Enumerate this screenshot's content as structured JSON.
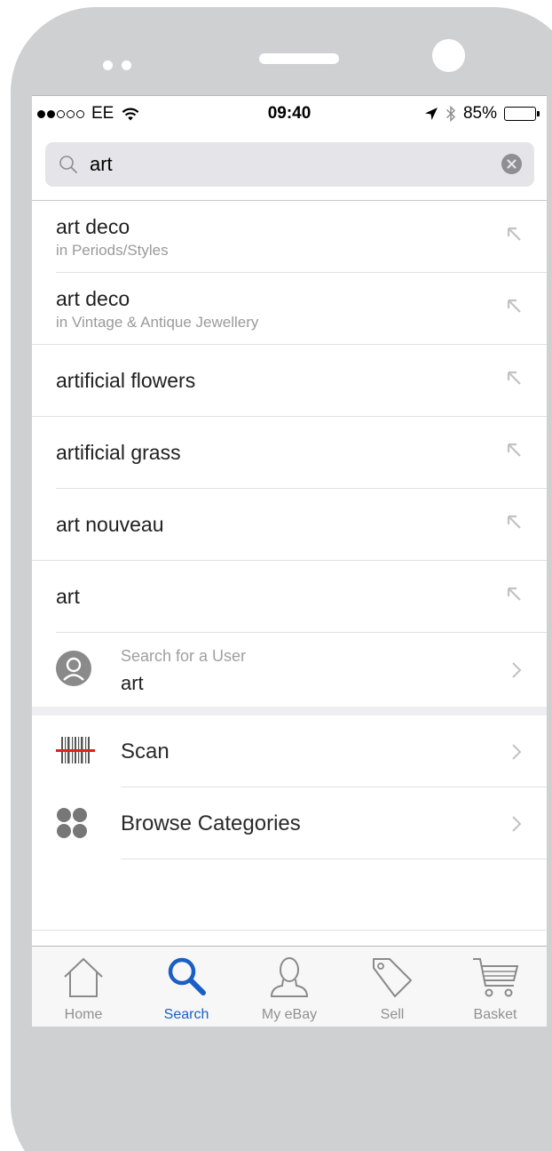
{
  "status_bar": {
    "carrier": "EE",
    "time": "09:40",
    "battery": "85%",
    "battery_level": 0.85,
    "signal_bars_filled": 2,
    "signal_bars_total": 5
  },
  "search": {
    "value": "art",
    "placeholder": ""
  },
  "suggestions": [
    {
      "title": "art deco",
      "subtitle": "in Periods/Styles"
    },
    {
      "title": "art deco",
      "subtitle": "in Vintage & Antique Jewellery"
    },
    {
      "title": "artificial flowers"
    },
    {
      "title": "artificial grass"
    },
    {
      "title": "art nouveau"
    },
    {
      "title": "art"
    }
  ],
  "user_search": {
    "label": "Search for a User",
    "value": "art"
  },
  "options": {
    "scan_label": "Scan",
    "browse_label": "Browse Categories"
  },
  "tabs": [
    {
      "label": "Home",
      "icon": "home-icon"
    },
    {
      "label": "Search",
      "icon": "search-icon",
      "active": true
    },
    {
      "label": "My eBay",
      "icon": "user-icon"
    },
    {
      "label": "Sell",
      "icon": "tag-icon"
    },
    {
      "label": "Basket",
      "icon": "basket-icon"
    }
  ],
  "colors": {
    "accent": "#1a5fc6",
    "scan_line": "#e02020",
    "frame": "#cfd0d2"
  }
}
